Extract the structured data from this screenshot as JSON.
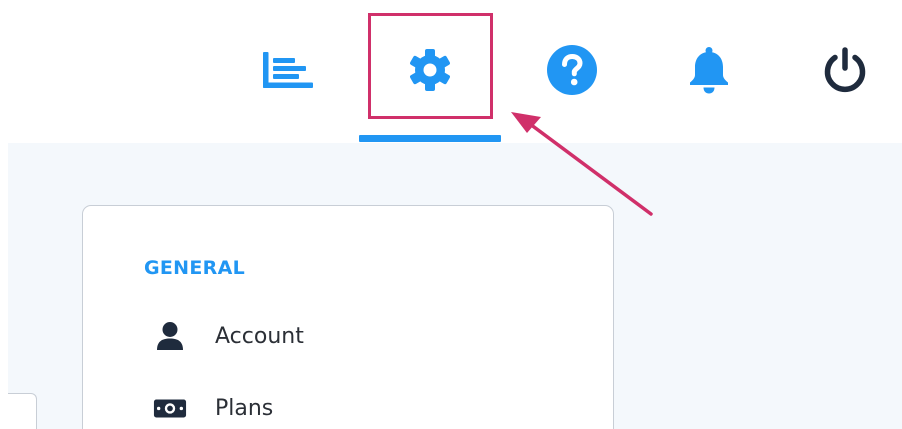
{
  "nav": {
    "items": [
      {
        "id": "reports",
        "icon": "bar-chart-icon"
      },
      {
        "id": "settings",
        "icon": "gear-icon",
        "active": true
      },
      {
        "id": "help",
        "icon": "question-circle-icon"
      },
      {
        "id": "alerts",
        "icon": "bell-icon"
      },
      {
        "id": "logout",
        "icon": "power-icon"
      }
    ]
  },
  "settings_card": {
    "section_heading": "GENERAL",
    "items": [
      {
        "label": "Account",
        "icon": "user-icon"
      },
      {
        "label": "Plans",
        "icon": "money-bill-icon"
      }
    ]
  },
  "colors": {
    "primary": "#2196f3",
    "dark": "#1f2b3d",
    "annotation": "#d0306a",
    "content_bg": "#f4f8fc"
  }
}
